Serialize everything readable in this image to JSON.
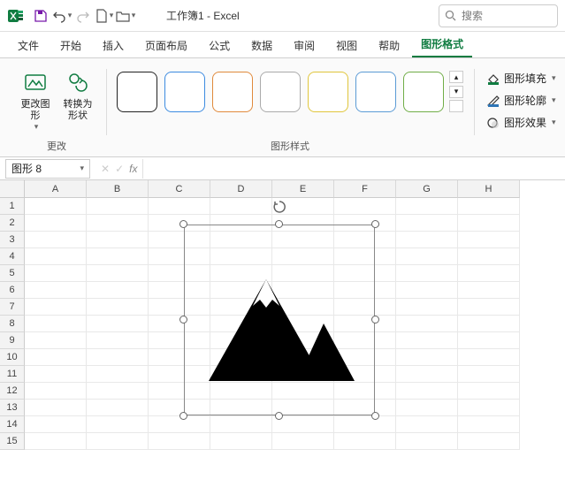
{
  "title": "工作簿1 - Excel",
  "search_placeholder": "搜索",
  "tabs": [
    "文件",
    "开始",
    "插入",
    "页面布局",
    "公式",
    "数据",
    "审阅",
    "视图",
    "帮助",
    "图形格式"
  ],
  "active_tab_index": 9,
  "ribbon": {
    "group_change": {
      "label": "更改",
      "change_graphic": "更改图形",
      "convert_shape": "转换为形状"
    },
    "group_styles": {
      "label": "图形样式"
    },
    "fill": "图形填充",
    "outline": "图形轮廓",
    "effects": "图形效果"
  },
  "namebox_value": "图形 8",
  "fx_label": "fx",
  "columns": [
    "A",
    "B",
    "C",
    "D",
    "E",
    "F",
    "G",
    "H"
  ],
  "row_count": 15
}
